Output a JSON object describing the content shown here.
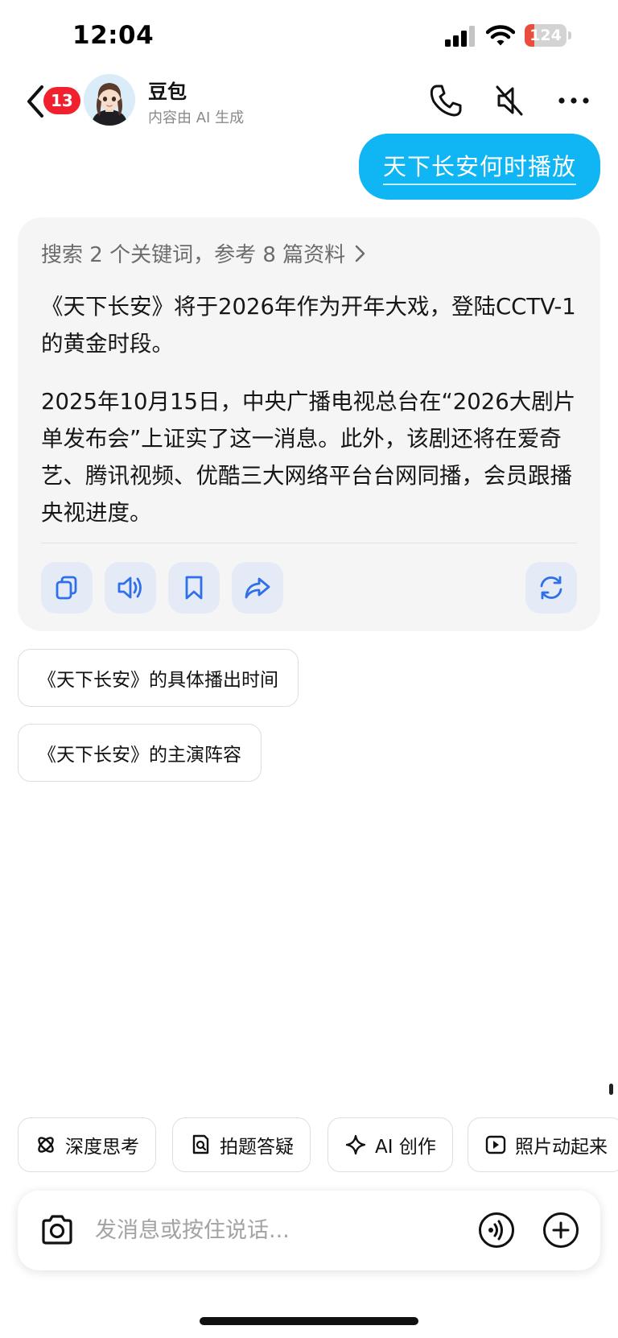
{
  "status_bar": {
    "time": "12:04",
    "battery_level": "124",
    "battery_percent": 0.24,
    "battery_color": "#eb4d3d"
  },
  "header": {
    "unread_count": "13",
    "bot_name": "豆包",
    "subtitle": "内容由 AI 生成",
    "icons": [
      "back-icon",
      "phone-icon",
      "mute-speaker-icon",
      "more-icon"
    ]
  },
  "conversation": {
    "user_message": "天下长安何时播放",
    "search_summary": "搜索 2 个关键词，参考 8 篇资料",
    "answer_paragraphs": [
      "《天下长安》将于2026年作为开年大戏，登陆CCTV-1的黄金时段。",
      "2025年10月15日，中央广播电视总台在“2026大剧片单发布会”上证实了这一消息。此外，该剧还将在爱奇艺、腾讯视频、优酷三大网络平台台网同播，会员跟播央视进度。"
    ],
    "action_icons": [
      "copy-icon",
      "speaker-icon",
      "bookmark-icon",
      "share-icon",
      "regenerate-icon"
    ]
  },
  "suggestions": [
    "《天下长安》的具体播出时间",
    "《天下长安》的主演阵容"
  ],
  "tools": [
    {
      "label": "深度思考",
      "icon": "atom-icon"
    },
    {
      "label": "拍题答疑",
      "icon": "doc-search-icon"
    },
    {
      "label": "AI 创作",
      "icon": "sparkle-icon"
    },
    {
      "label": "照片动起来",
      "icon": "play-icon"
    }
  ],
  "input": {
    "placeholder": "发消息或按住说话...",
    "value": ""
  },
  "colors": {
    "accent": "#10b6f3",
    "badge": "#f0202e",
    "action_icon": "#2f6fea",
    "card_bg": "#f5f5f6"
  }
}
